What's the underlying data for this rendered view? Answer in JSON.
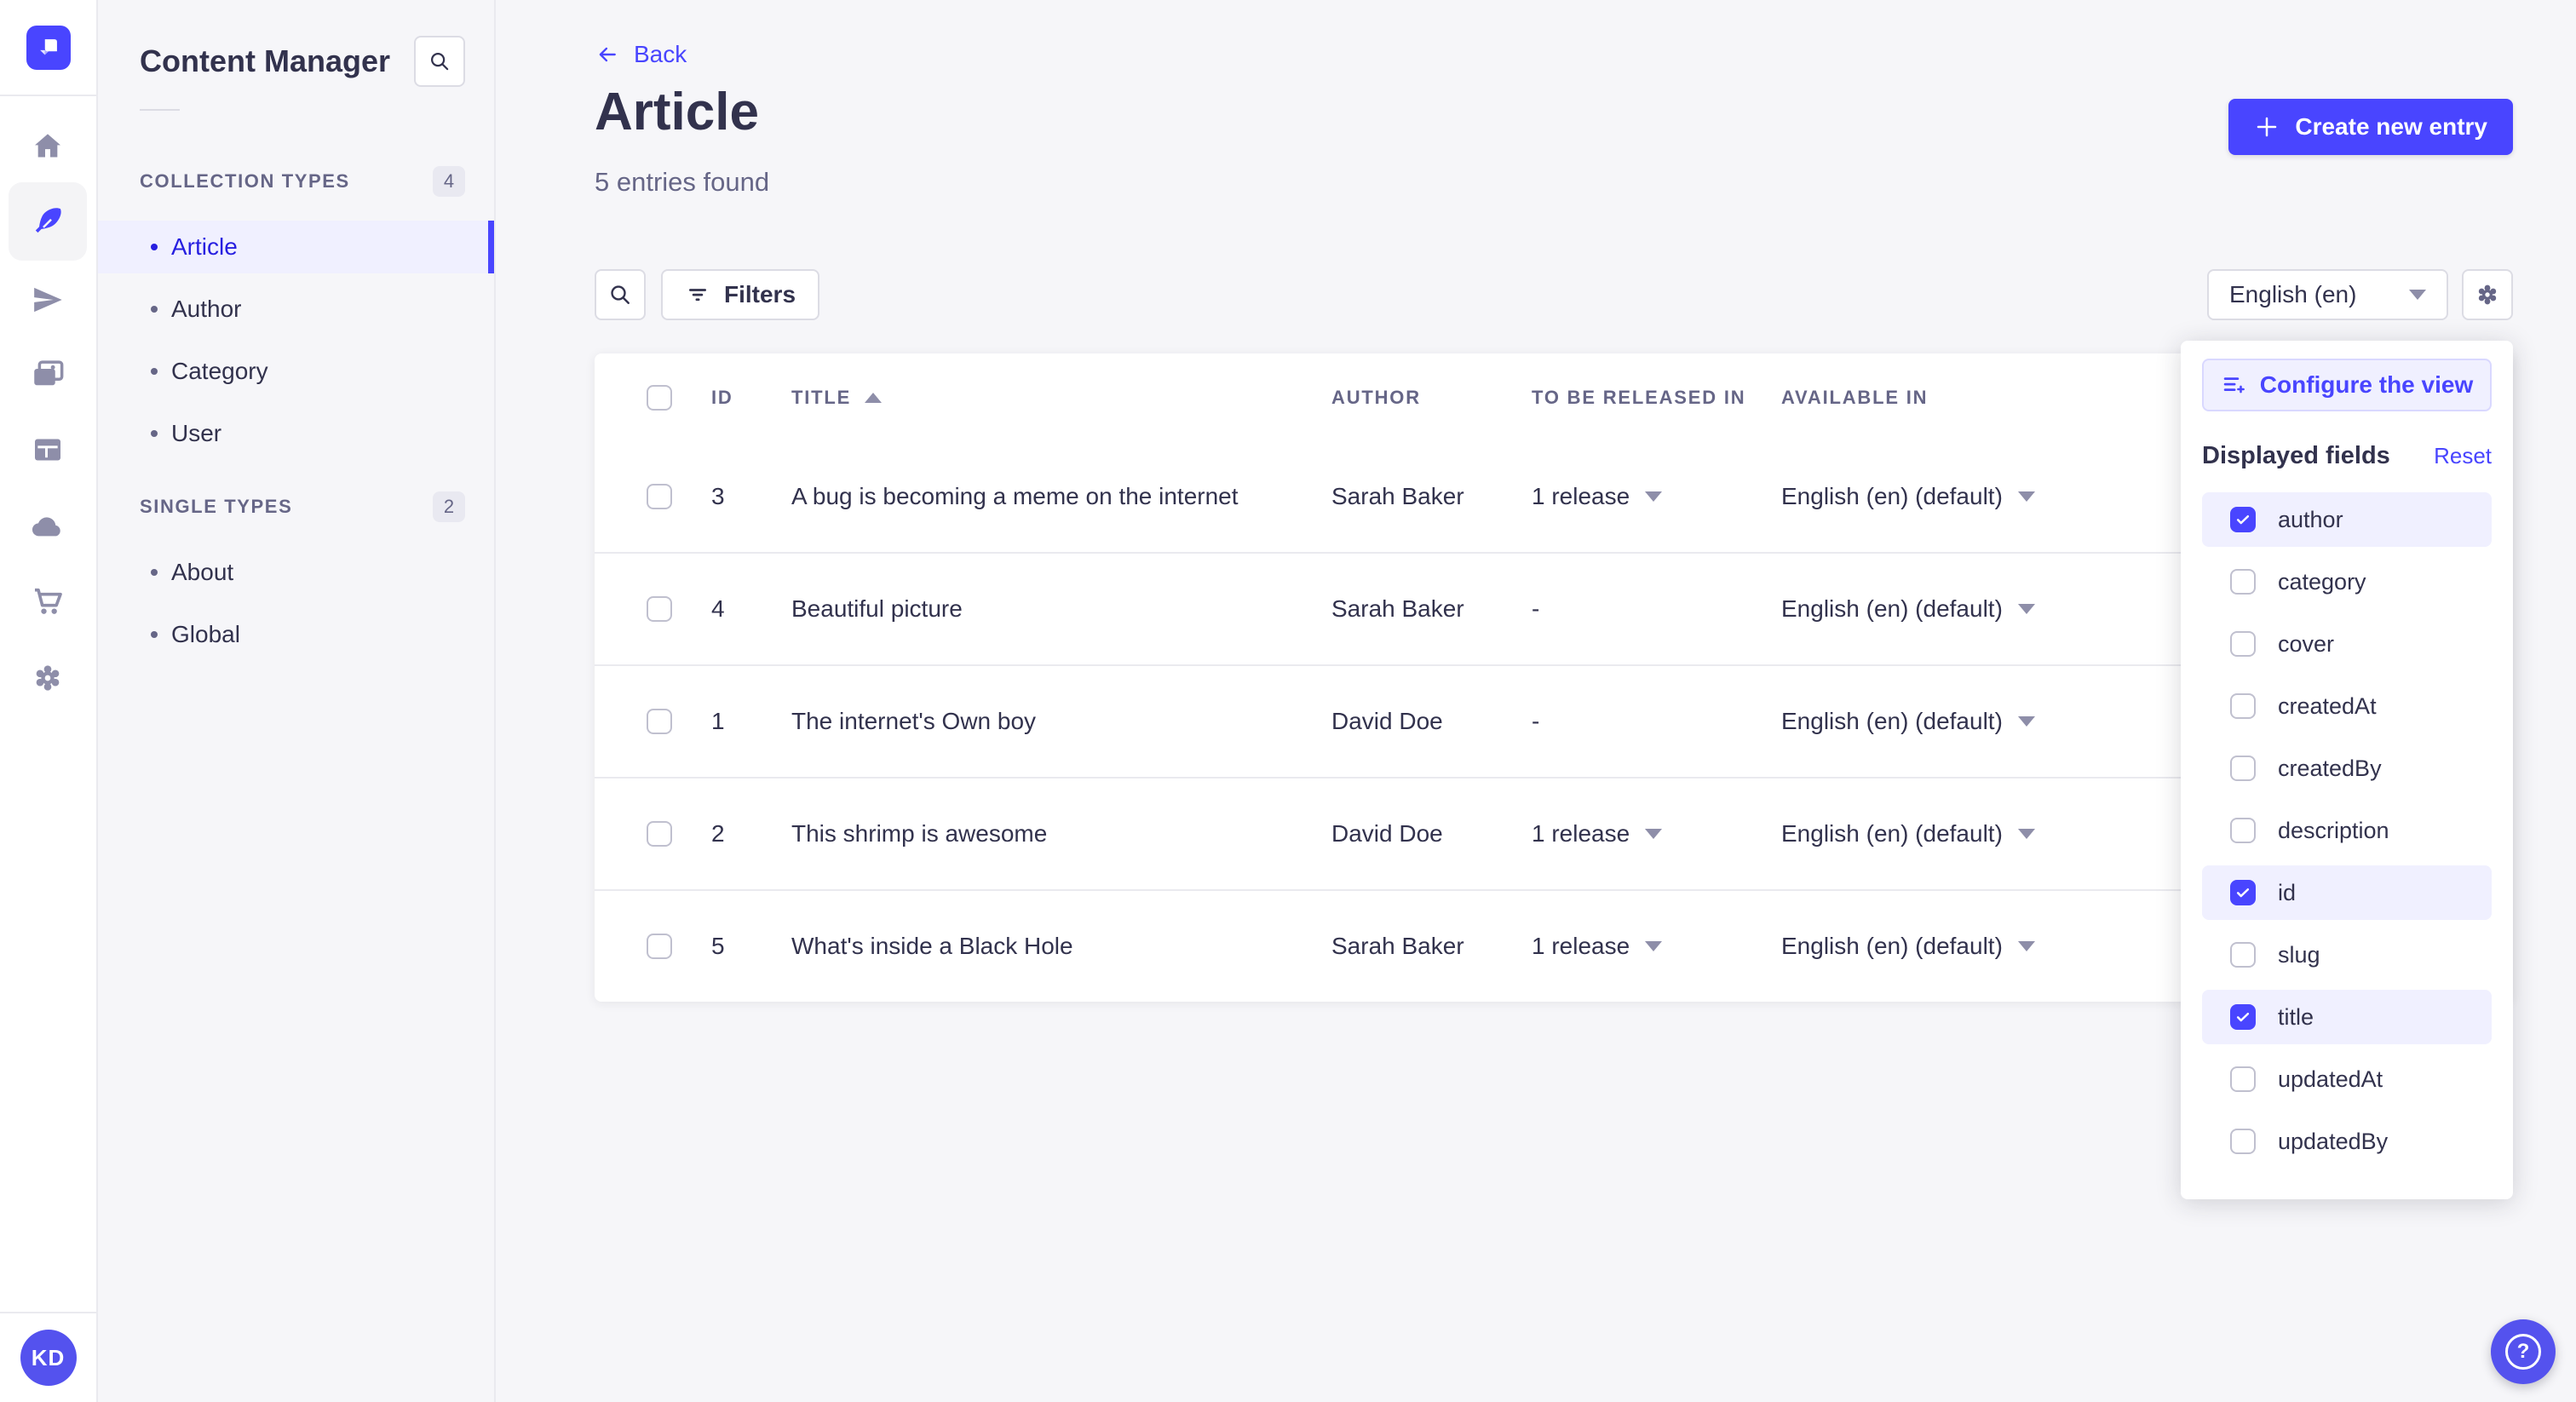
{
  "colors": {
    "accent": "#4945ff",
    "accent_dark": "#271fe0",
    "highlight": "#f0f0ff",
    "background": "#f6f6f9",
    "text": "#32324d",
    "muted": "#666687",
    "border": "#dcdce4"
  },
  "rail": {
    "icons": [
      "strapi-logo",
      "home",
      "content-manager-feather",
      "releases-paper-plane",
      "media-library-images",
      "content-type-builder-layout",
      "deploy-cloud",
      "marketplace-cart",
      "settings-gear"
    ],
    "avatar_initials": "KD"
  },
  "subnav": {
    "title": "Content Manager",
    "collection_types": {
      "label": "COLLECTION TYPES",
      "count": "4",
      "items": [
        {
          "label": "Article",
          "active": true
        },
        {
          "label": "Author",
          "active": false
        },
        {
          "label": "Category",
          "active": false
        },
        {
          "label": "User",
          "active": false
        }
      ]
    },
    "single_types": {
      "label": "SINGLE TYPES",
      "count": "2",
      "items": [
        {
          "label": "About",
          "active": false
        },
        {
          "label": "Global",
          "active": false
        }
      ]
    }
  },
  "header": {
    "back_label": "Back",
    "title": "Article",
    "entries_count": "5 entries found",
    "create_button_label": "Create new entry"
  },
  "toolbar": {
    "filters_label": "Filters",
    "locale_value": "English (en)"
  },
  "table": {
    "headers": {
      "id": "ID",
      "title": "TITLE",
      "author": "AUTHOR",
      "to_be_released_in": "TO BE RELEASED IN",
      "available_in": "AVAILABLE IN"
    },
    "sort": {
      "column": "TITLE",
      "direction": "ascending"
    },
    "rows": [
      {
        "id": "3",
        "title": "A bug is becoming a meme on the internet",
        "author": "Sarah Baker",
        "to_be_released_in": "1 release",
        "available_in": "English (en) (default)"
      },
      {
        "id": "4",
        "title": "Beautiful picture",
        "author": "Sarah Baker",
        "to_be_released_in": "-",
        "available_in": "English (en) (default)"
      },
      {
        "id": "1",
        "title": "The internet's Own boy",
        "author": "David Doe",
        "to_be_released_in": "-",
        "available_in": "English (en) (default)"
      },
      {
        "id": "2",
        "title": "This shrimp is awesome",
        "author": "David Doe",
        "to_be_released_in": "1 release",
        "available_in": "English (en) (default)"
      },
      {
        "id": "5",
        "title": "What's inside a Black Hole",
        "author": "Sarah Baker",
        "to_be_released_in": "1 release",
        "available_in": "English (en) (default)"
      }
    ]
  },
  "popover": {
    "configure_label": "Configure the view",
    "displayed_fields_label": "Displayed fields",
    "reset_label": "Reset",
    "fields": [
      {
        "label": "author",
        "checked": true
      },
      {
        "label": "category",
        "checked": false
      },
      {
        "label": "cover",
        "checked": false
      },
      {
        "label": "createdAt",
        "checked": false
      },
      {
        "label": "createdBy",
        "checked": false
      },
      {
        "label": "description",
        "checked": false
      },
      {
        "label": "id",
        "checked": true
      },
      {
        "label": "slug",
        "checked": false
      },
      {
        "label": "title",
        "checked": true
      },
      {
        "label": "updatedAt",
        "checked": false
      },
      {
        "label": "updatedBy",
        "checked": false
      }
    ]
  },
  "footer": {
    "help_icon_glyph": "?"
  }
}
